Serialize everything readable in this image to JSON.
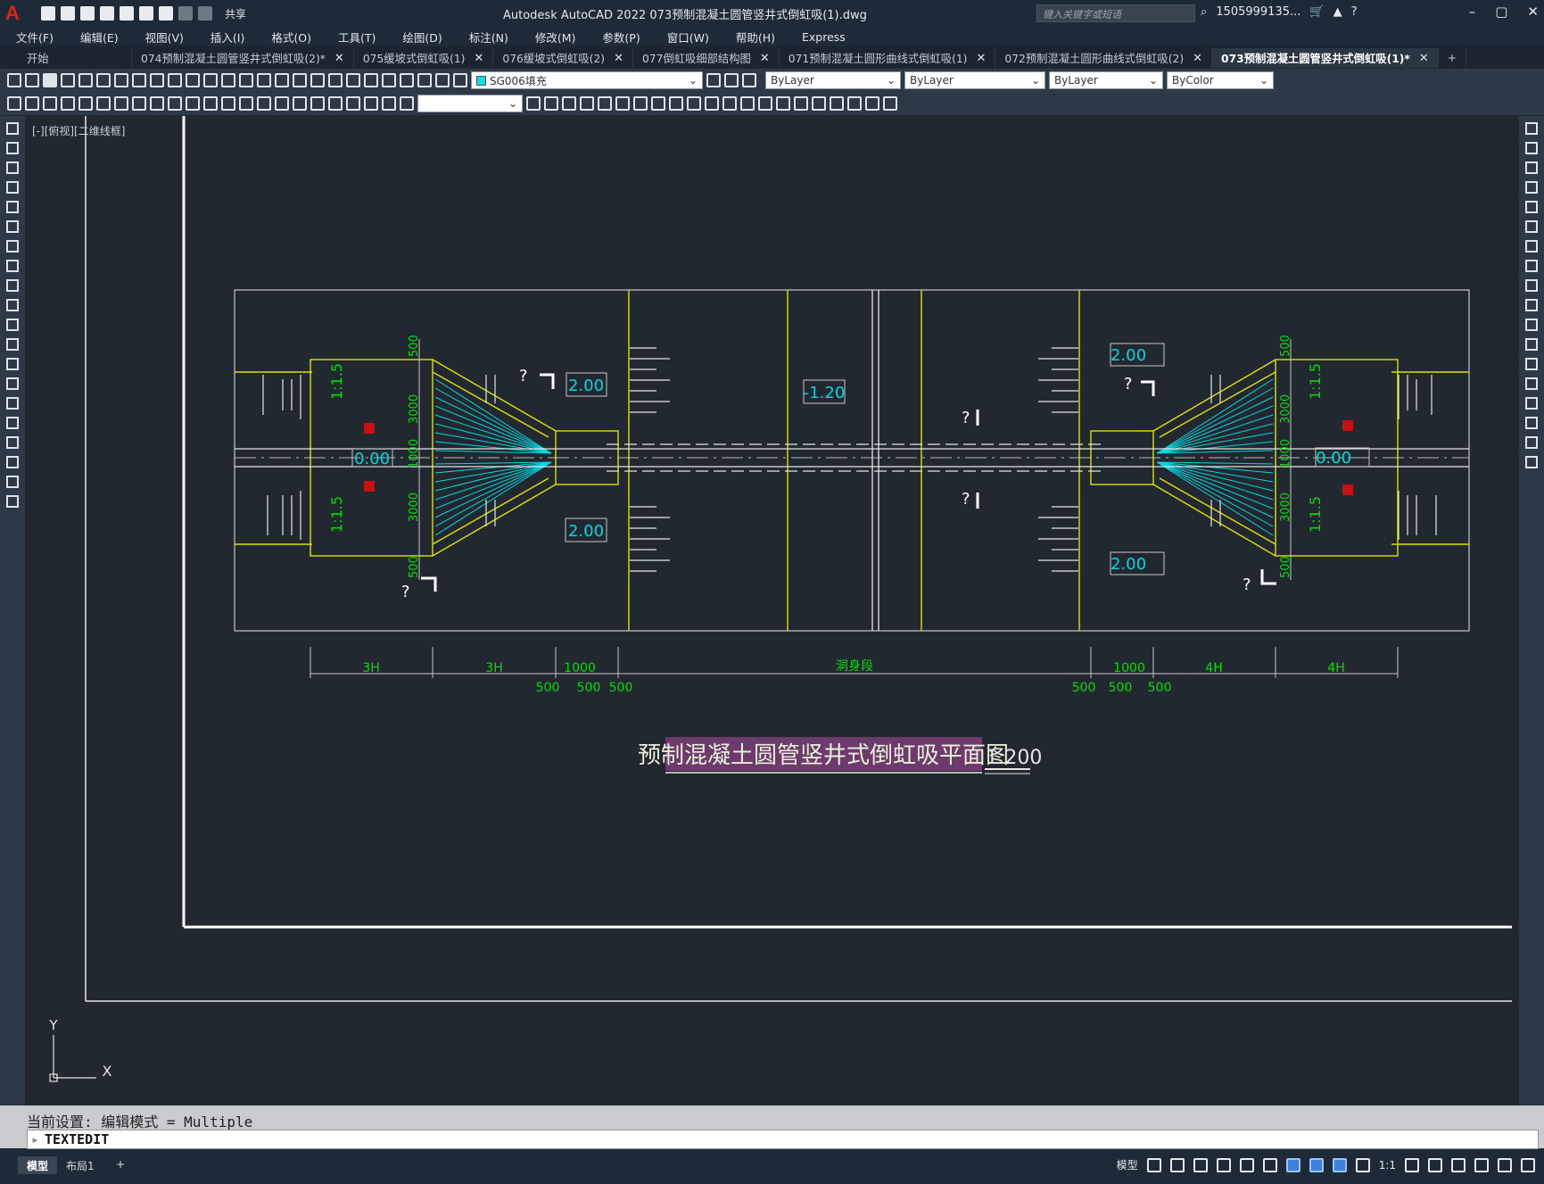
{
  "app": {
    "title": "Autodesk AutoCAD 2022    073预制混凝土圆管竖井式倒虹吸(1).dwg",
    "share": "共享",
    "search_placeholder": "键入关键字或短语",
    "user": "1505999135...",
    "window_controls": [
      "–",
      "▢",
      "✕"
    ]
  },
  "menu": [
    "文件(F)",
    "编辑(E)",
    "视图(V)",
    "插入(I)",
    "格式(O)",
    "工具(T)",
    "绘图(D)",
    "标注(N)",
    "修改(M)",
    "参数(P)",
    "窗口(W)",
    "帮助(H)",
    "Express"
  ],
  "tabs": [
    {
      "label": "开始",
      "closable": false,
      "active": false
    },
    {
      "label": "074预制混凝土圆管竖井式倒虹吸(2)*",
      "closable": true,
      "active": false
    },
    {
      "label": "075缓坡式倒虹吸(1)",
      "closable": true,
      "active": false
    },
    {
      "label": "076缓坡式倒虹吸(2)",
      "closable": true,
      "active": false
    },
    {
      "label": "077倒虹吸细部结构图",
      "closable": true,
      "active": false
    },
    {
      "label": "071预制混凝土圆形曲线式倒虹吸(1)",
      "closable": true,
      "active": false
    },
    {
      "label": "072预制混凝土圆形曲线式倒虹吸(2)",
      "closable": true,
      "active": false
    },
    {
      "label": "073预制混凝土圆管竖井式倒虹吸(1)*",
      "closable": true,
      "active": true
    }
  ],
  "properties": {
    "layer": "SG006填充",
    "layer_color": "#00e5e5",
    "color": "ByLayer",
    "linetype": "ByLayer",
    "lineweight": "ByLayer",
    "plotstyle": "ByColor"
  },
  "viewport_label": "[-][俯视][二维线框]",
  "drawing": {
    "title": "预制混凝土圆管竖井式倒虹吸平面图",
    "scale": "1:200",
    "elevations": {
      "left_upper": "2.00",
      "left_lower": "2.00",
      "center": "-1.20",
      "left_axis": "0.00",
      "right_upper": "2.00",
      "right_lower": "2.00",
      "right_axis": "0.00"
    },
    "slope": "1:1.5",
    "dim_bottom_left": [
      "3H",
      "3H"
    ],
    "dim_bottom_right": [
      "4H",
      "4H"
    ],
    "dim_mid": "洞身段",
    "dim_small": [
      "500",
      "500",
      "500",
      "1000"
    ],
    "dim_vertical": [
      "500",
      "3000",
      "1000",
      "3000",
      "500"
    ],
    "question": "?",
    "colors": {
      "background": "#212830",
      "outline": "#c8c8c8",
      "yellow": "#e0e000",
      "cyan": "#00d8e0",
      "green": "#00e000",
      "red": "#c81010",
      "title_bg": "#6e3a6e"
    }
  },
  "ucs": {
    "x": "X",
    "y": "Y"
  },
  "command": {
    "history": "当前设置: 编辑模式 = Multiple",
    "current": "TEXTEDIT"
  },
  "layouts": [
    "模型",
    "布局1",
    "+"
  ],
  "status": {
    "model": "模型",
    "scale": "1:1"
  }
}
